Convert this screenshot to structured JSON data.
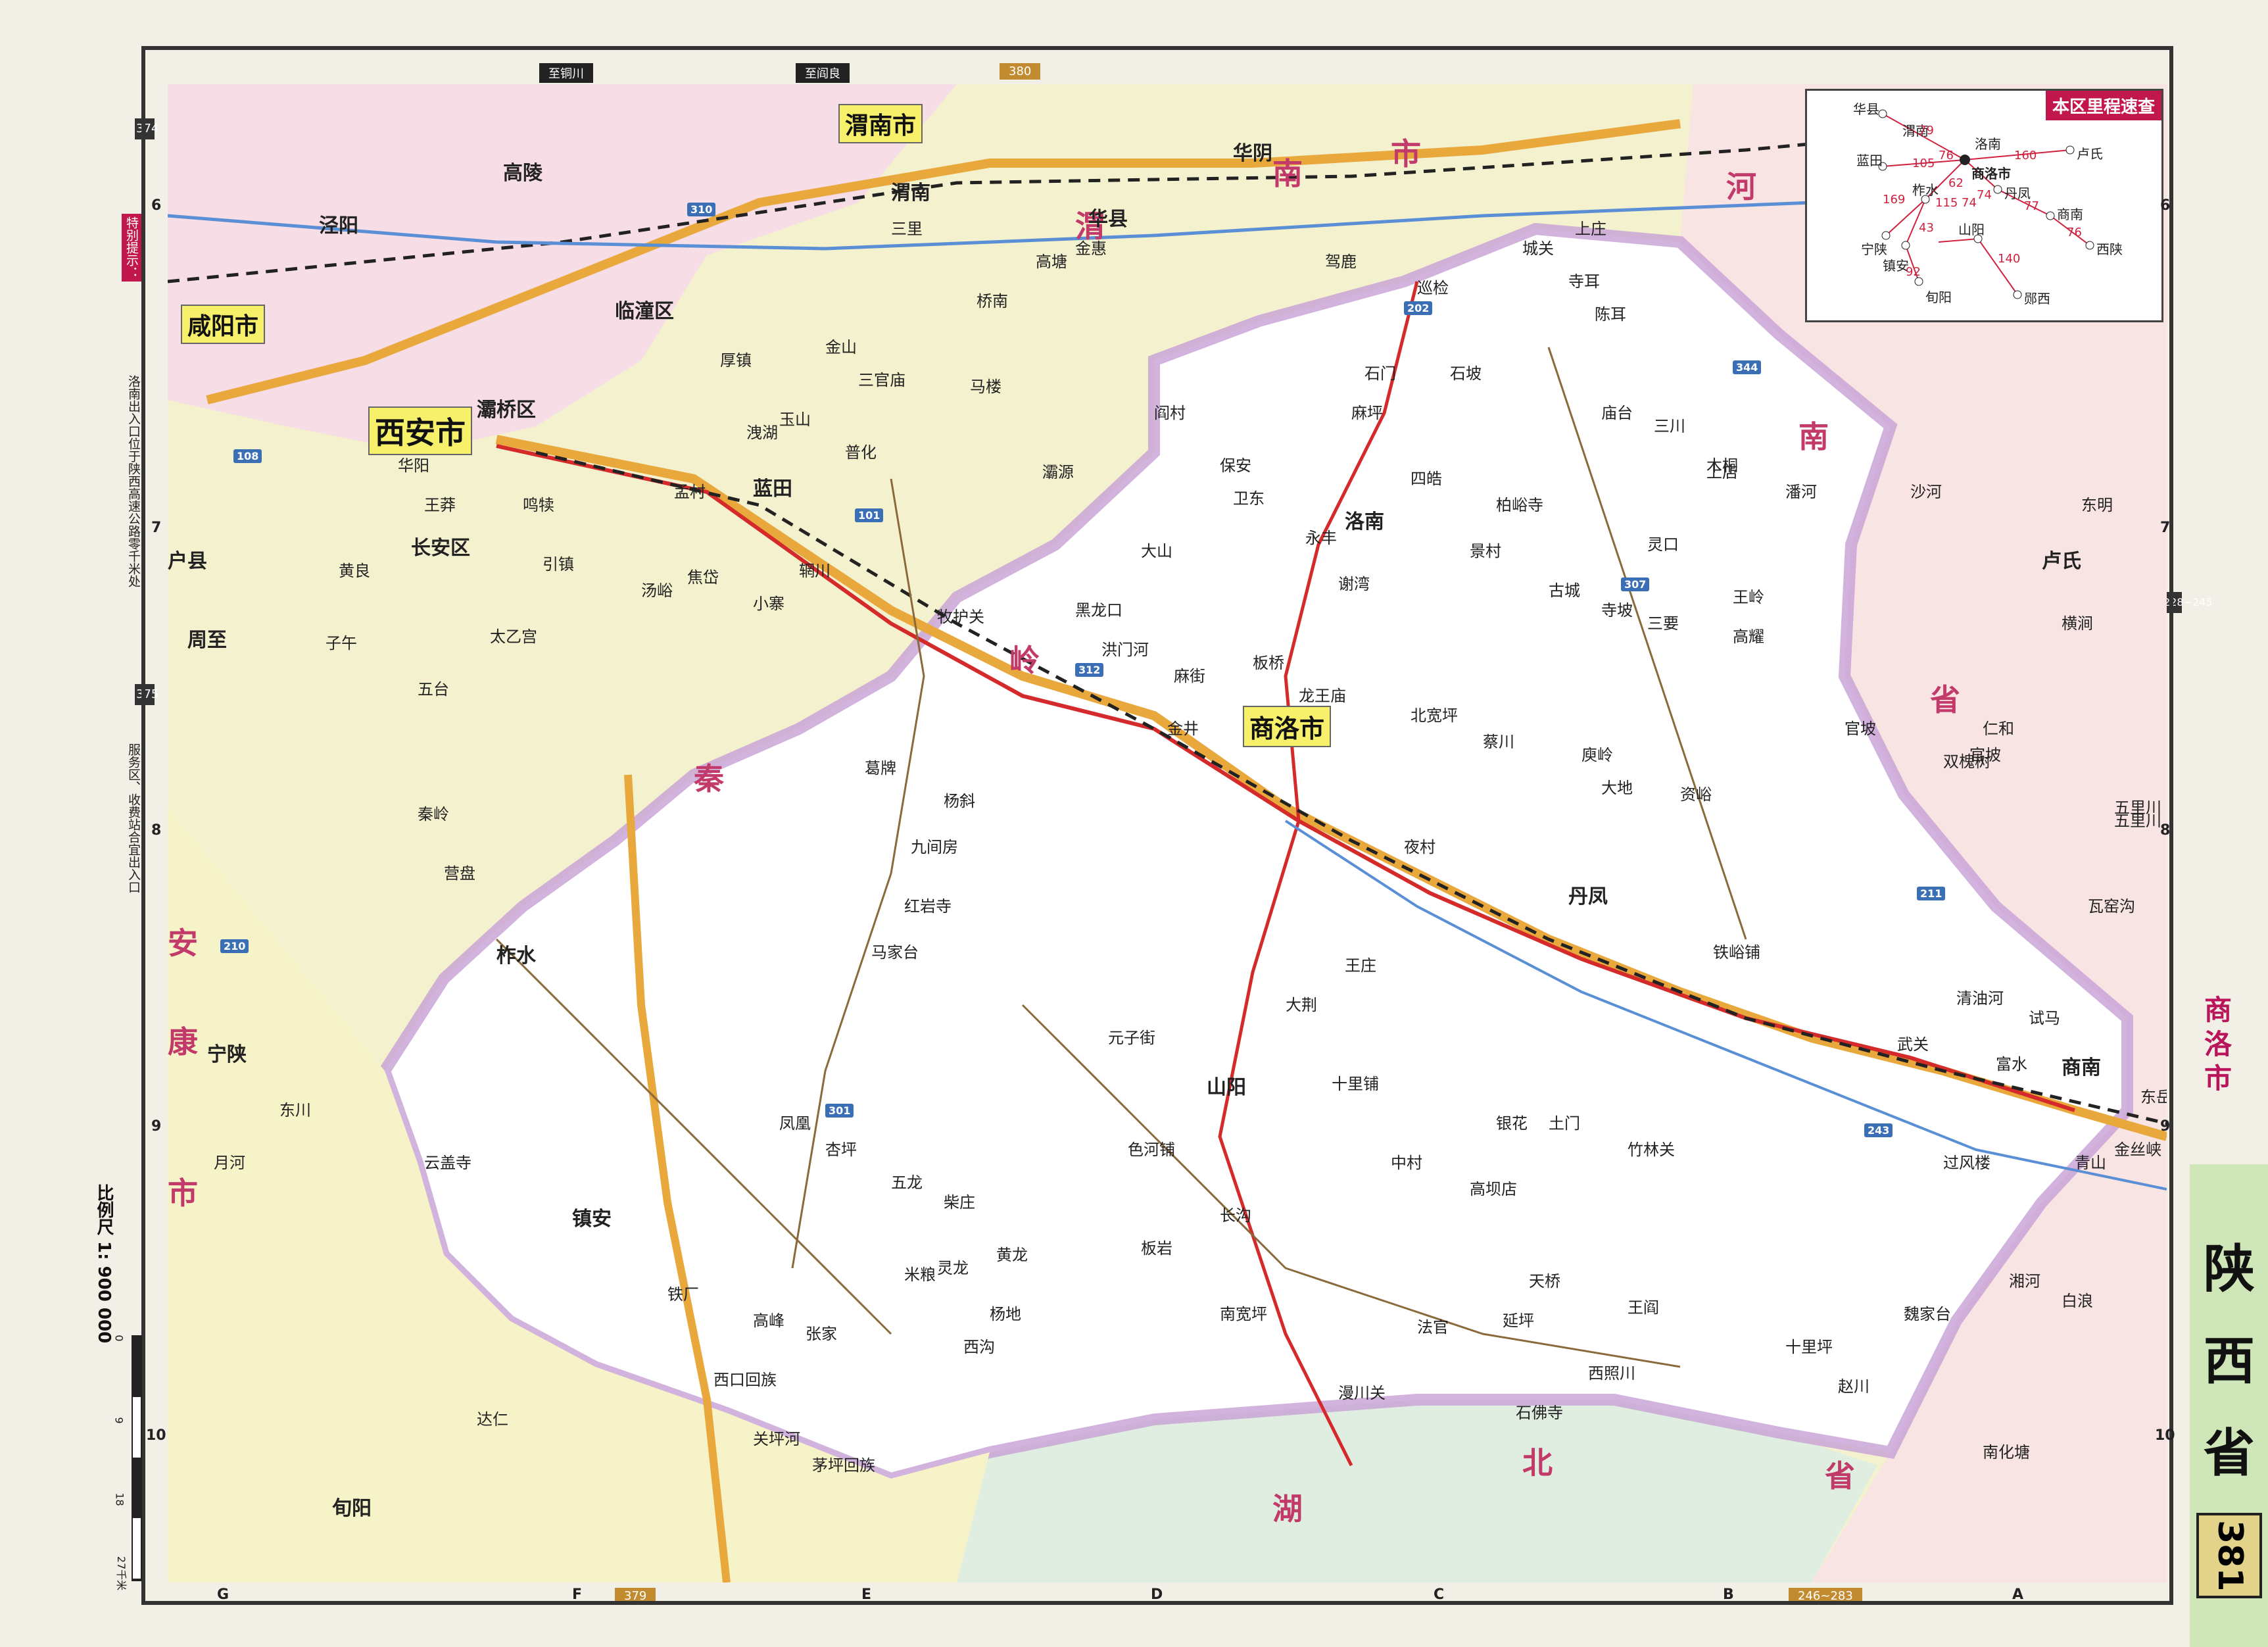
{
  "map_title": "本区里程速查",
  "province": "陕西省",
  "city_tab": "商洛市",
  "page_number": "381",
  "scale": "比例尺 1: 900 000",
  "scale_ticks": [
    "0",
    "9",
    "18",
    "27千米"
  ],
  "top_tabs": [
    "至铜川",
    "至阎良",
    "380"
  ],
  "bottom_tabs": [
    "379",
    "246~283"
  ],
  "left_tabs": [
    "374",
    "375"
  ],
  "right_tabs": [
    "228~245"
  ],
  "left_notes": [
    "特别提示：",
    "洛南出入口位于陕西高速公路零千米处",
    "服务区、收费站合宜出入口"
  ],
  "grid_letters": [
    "G",
    "F",
    "E",
    "D",
    "C",
    "B",
    "A"
  ],
  "grid_numbers": [
    "6",
    "7",
    "8",
    "9",
    "10"
  ],
  "cities": [
    {
      "name": "西安市"
    },
    {
      "name": "商洛市"
    },
    {
      "name": "渭南市"
    },
    {
      "name": "咸阳市"
    }
  ],
  "regions": [
    {
      "name": "河"
    },
    {
      "name": "南"
    },
    {
      "name": "省"
    },
    {
      "name": "湖"
    },
    {
      "name": "北"
    },
    {
      "name": "省"
    },
    {
      "name": "安"
    },
    {
      "name": "康"
    },
    {
      "name": "市"
    },
    {
      "name": "秦"
    },
    {
      "name": "岭"
    },
    {
      "name": "渭"
    },
    {
      "name": "南"
    },
    {
      "name": "市"
    }
  ],
  "towns": [
    "临潼区",
    "灞桥区",
    "长安区",
    "蓝田",
    "洛南",
    "丹凤",
    "商南",
    "山阳",
    "镇安",
    "柞水",
    "卢氏",
    "华县",
    "华阴",
    "渭南",
    "泾阳",
    "高陵",
    "户县",
    "周至",
    "宁陕",
    "旬阳",
    "杨斜",
    "黑龙口",
    "麻街",
    "板桥",
    "夜村",
    "武关",
    "赵川",
    "漫川关",
    "竹林关",
    "高坝店",
    "中村",
    "色河铺",
    "土门",
    "十里铺",
    "银花",
    "金井",
    "官坡",
    "五里川",
    "瓦窑沟",
    "横涧",
    "乔山",
    "石门",
    "灵口",
    "三要",
    "景村",
    "古城",
    "寺坡",
    "柏峪寺",
    "上庄",
    "三川",
    "秦岭",
    "营盘",
    "月河",
    "达仁",
    "东川",
    "云盖寺",
    "米粮",
    "茅坪回族",
    "西口回族",
    "关坪河",
    "南宽坪",
    "高峰",
    "凤凰",
    "杏坪",
    "龙王庙",
    "北宽坪",
    "蔡川",
    "大地",
    "资峪",
    "庾岭",
    "铁峪铺",
    "清油河",
    "过风楼",
    "白浪",
    "湘河",
    "魏家台",
    "十里坪",
    "石佛寺",
    "西照川",
    "法官",
    "天桥",
    "南化塘",
    "东岳",
    "青山",
    "金丝峡",
    "试马",
    "富水",
    "王阎",
    "大荆",
    "王庄",
    "延坪",
    "高耀",
    "洪门河",
    "保安",
    "王岭",
    "四皓",
    "卫东",
    "永丰",
    "谢湾",
    "陈耳",
    "巡检",
    "驾鹿",
    "寺耳",
    "石坡",
    "城关",
    "麻坪",
    "庙台",
    "上店",
    "马家台",
    "杨地",
    "柴庄",
    "灵龙",
    "黄龙",
    "铁厂",
    "张家",
    "西沟",
    "红岩寺",
    "长沟",
    "元子街",
    "五龙",
    "板岩",
    "双槐树",
    "沙河",
    "五里川",
    "潘河",
    "东明",
    "官坡",
    "木桐",
    "仁和",
    "大山",
    "九间房",
    "葛牌",
    "牧护关",
    "辋川",
    "小寨",
    "马楼",
    "汤峪",
    "焦岱",
    "玉山",
    "普化",
    "孟村",
    "厚镇",
    "灞源",
    "三官庙",
    "金山",
    "洩湖",
    "阎村",
    "桥南",
    "高塘",
    "金惠",
    "三里",
    "华阳",
    "黄良",
    "鸣犊",
    "引镇",
    "王莽",
    "五台",
    "太乙宫",
    "子午"
  ],
  "routes": [
    "312",
    "101",
    "310",
    "108",
    "210",
    "307",
    "211",
    "202",
    "301",
    "344",
    "243"
  ],
  "inset": {
    "title": "本区里程速查",
    "places": [
      "华县",
      "渭南",
      "蓝田",
      "洛南",
      "卢氏",
      "柞水",
      "商洛市",
      "丹凤",
      "商南",
      "宁陕",
      "镇安",
      "山阳",
      "西陕",
      "旬阳",
      "郧西"
    ],
    "distances": [
      "79",
      "76",
      "160",
      "105",
      "74",
      "115",
      "62",
      "77",
      "76",
      "169",
      "43",
      "74",
      "140",
      "92"
    ]
  }
}
